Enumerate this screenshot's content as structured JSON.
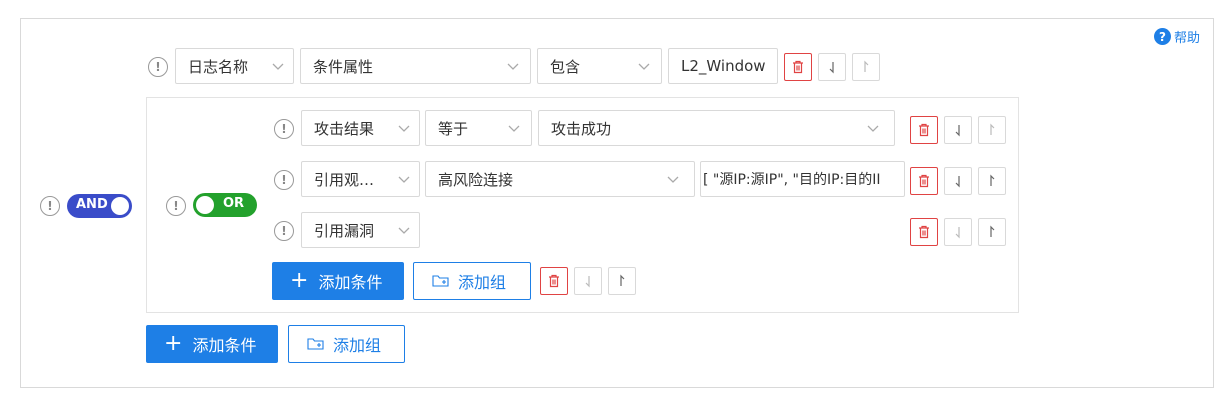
{
  "help": {
    "icon": "question-circle-icon",
    "label": "帮助"
  },
  "colors": {
    "primary": "#1e7fe6",
    "and_toggle": "#3a4cc9",
    "or_toggle": "#23a12c",
    "delete": "#e04343"
  },
  "root": {
    "operator": "AND",
    "condition": {
      "field": "日志名称",
      "attribute": "条件属性",
      "op": "包含",
      "value": "L2_Window"
    },
    "group": {
      "operator": "OR",
      "rows": [
        {
          "field": "攻击结果",
          "op": "等于",
          "value": "攻击成功"
        },
        {
          "field": "引用观…",
          "op": "高风险连接",
          "value": "[ \"源IP:源IP\", \"目的IP:目的II"
        },
        {
          "field": "引用漏洞"
        }
      ],
      "add_condition": "添加条件",
      "add_group": "添加组"
    },
    "add_condition": "添加条件",
    "add_group": "添加组"
  }
}
